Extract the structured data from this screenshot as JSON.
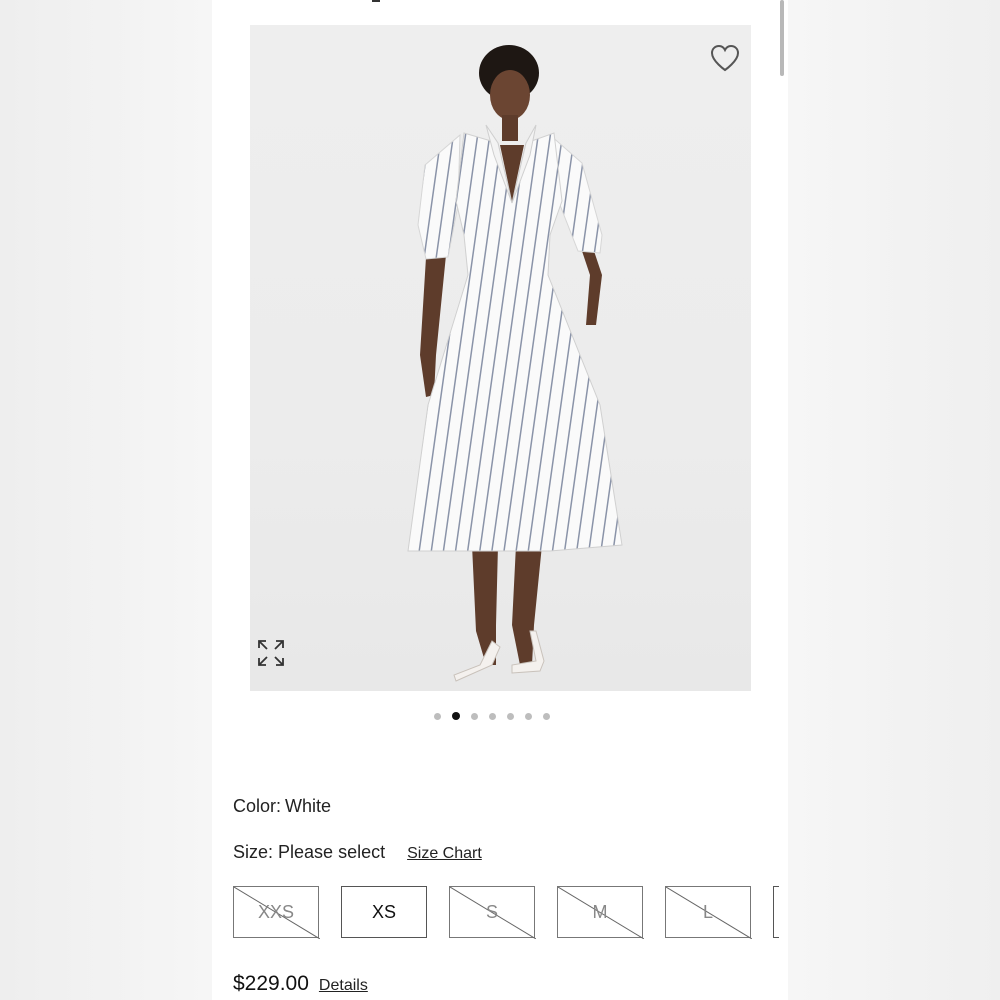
{
  "product": {
    "color_label": "Color:",
    "color_value": "White",
    "size_label": "Size:",
    "size_value": "Please select",
    "size_chart_link": "Size Chart",
    "sizes": [
      {
        "label": "XXS",
        "available": false
      },
      {
        "label": "XS",
        "available": true
      },
      {
        "label": "S",
        "available": false
      },
      {
        "label": "M",
        "available": false
      },
      {
        "label": "L",
        "available": false
      }
    ],
    "price": "$229.00",
    "details_link": "Details"
  },
  "gallery": {
    "image_count": 7,
    "active_index": 1,
    "icons": {
      "favorite": "heart-outline-icon",
      "expand": "expand-arrows-icon"
    }
  },
  "colors": {
    "background": "#ffffff",
    "image_bg": "#ececec",
    "dot_active": "#111111",
    "dot_inactive": "#bdbdbd"
  }
}
